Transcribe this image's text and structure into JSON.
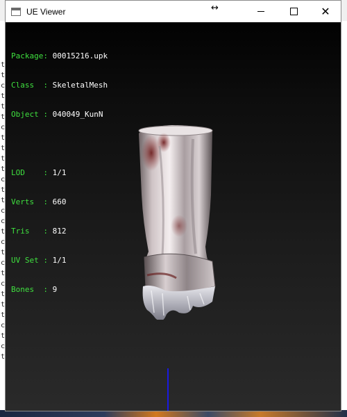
{
  "window": {
    "title": "UE Viewer",
    "resize_glyph": "↔",
    "close_glyph": "✕"
  },
  "info": {
    "package_label": "Package",
    "package_value": "00015216.upk",
    "class_label": "Class  ",
    "class_value": "SkeletalMesh",
    "object_label": "Object ",
    "object_value": "040049_KunN",
    "lod_label": "LOD    ",
    "lod_value": "1/1",
    "verts_label": "Verts  ",
    "verts_value": "660",
    "tris_label": "Tris   ",
    "tris_value": "812",
    "uvset_label": "UV Set ",
    "uvset_value": "1/1",
    "bones_label": "Bones  ",
    "bones_value": "9",
    "separator": ": "
  },
  "backdrop": {
    "left_chars": [
      "t",
      "t",
      "c",
      "t",
      "t",
      "t",
      "c",
      "t",
      "t",
      "t",
      "t",
      "c",
      "t",
      "t",
      "c",
      "c",
      "t",
      "c",
      "t",
      "c",
      "t",
      "c",
      "t",
      "t",
      "t",
      "c",
      "t",
      "c",
      "t"
    ]
  },
  "colors": {
    "label_green": "#3fe03f",
    "value_white": "#ffffff",
    "axis_blue": "#1a1ae0"
  }
}
